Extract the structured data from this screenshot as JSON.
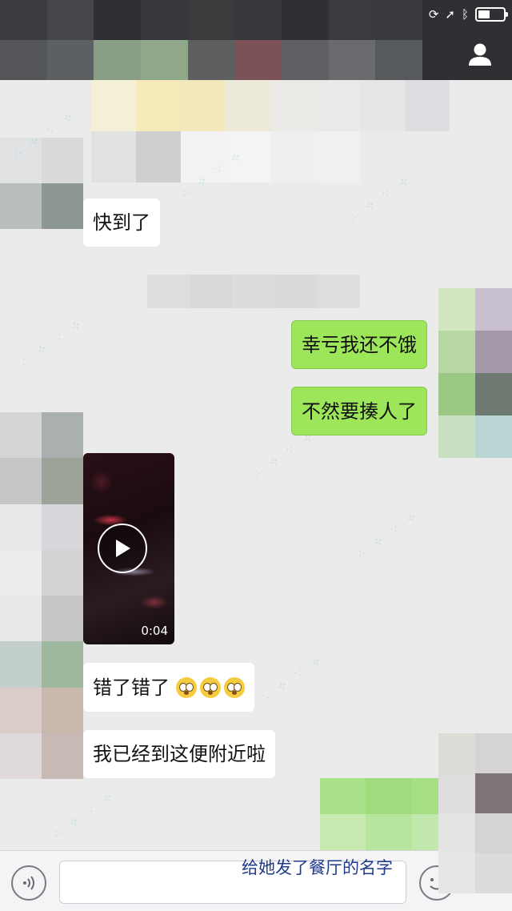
{
  "status_bar": {
    "icons": [
      "rotation-lock-icon",
      "location-arrow-icon",
      "bluetooth-icon",
      "battery-icon"
    ],
    "battery_level": 0.45
  },
  "navbar": {
    "right_icon": "profile-icon"
  },
  "messages": [
    {
      "side": "in",
      "type": "text",
      "text": "快到了"
    },
    {
      "side": "out",
      "type": "text",
      "text": "幸亏我还不饿"
    },
    {
      "side": "out",
      "type": "text",
      "text": "不然要揍人了"
    },
    {
      "side": "in",
      "type": "video",
      "duration": "0:04"
    },
    {
      "side": "in",
      "type": "text",
      "text": "错了错了",
      "emoji": "flushed-face-icon",
      "emoji_count": 3
    },
    {
      "side": "in",
      "type": "text",
      "text": "我已经到这便附近啦"
    }
  ],
  "annotation": "给她发了餐厅的名字",
  "input_bar": {
    "left_icon": "voice-icon",
    "right_icon": "emoji-icon"
  },
  "colors": {
    "background": "#ebebeb",
    "outgoing_bubble": "#9de65a",
    "incoming_bubble": "#ffffff",
    "annotation_text": "#1f3a8a"
  }
}
